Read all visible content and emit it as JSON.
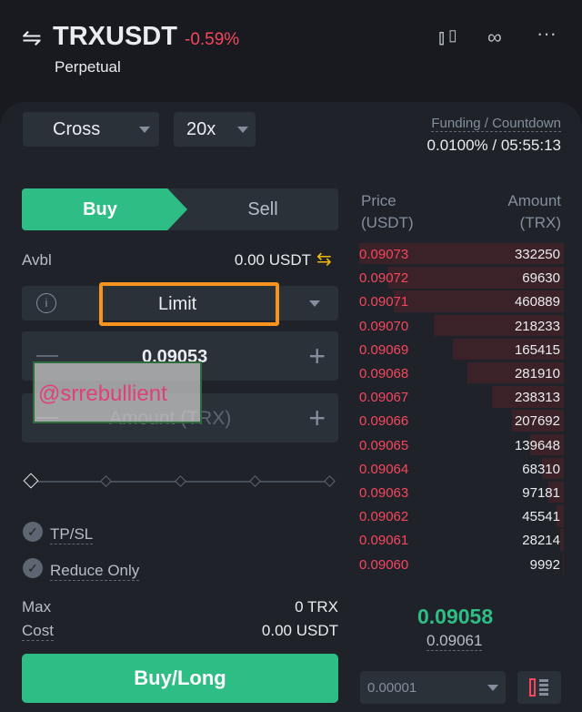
{
  "header": {
    "symbol": "TRXUSDT",
    "change": "-0.59%",
    "contract_type": "Perpetual",
    "icons": [
      "swap-icon",
      "candlestick-chart-icon",
      "link-icon",
      "more-icon"
    ]
  },
  "margin": {
    "mode": "Cross",
    "leverage": "20x"
  },
  "funding": {
    "label": "Funding / Countdown",
    "value": "0.0100% / 05:55:13"
  },
  "order": {
    "buy_label": "Buy",
    "sell_label": "Sell",
    "avbl_label": "Avbl",
    "avbl_value": "0.00 USDT",
    "order_type": "Limit",
    "price_value": "0.09053",
    "amount_placeholder": "Amount (TRX)",
    "slider_percent": 0,
    "tpsl_label": "TP/SL",
    "reduce_only_label": "Reduce Only",
    "max_label": "Max",
    "max_value": "0 TRX",
    "cost_label": "Cost",
    "cost_value": "0.00 USDT",
    "submit_label": "Buy/Long"
  },
  "watermark": "@srrebullient",
  "orderbook": {
    "price_header": "Price",
    "price_unit": "(USDT)",
    "amount_header": "Amount",
    "amount_unit": "(TRX)",
    "asks": [
      [
        "0.09073",
        "332250"
      ],
      [
        "0.09072",
        "69630"
      ],
      [
        "0.09071",
        "460889"
      ],
      [
        "0.09070",
        "218233"
      ],
      [
        "0.09069",
        "165415"
      ],
      [
        "0.09068",
        "281910"
      ],
      [
        "0.09067",
        "238313"
      ],
      [
        "0.09066",
        "207692"
      ],
      [
        "0.09065",
        "139648"
      ],
      [
        "0.09064",
        "68310"
      ],
      [
        "0.09063",
        "97181"
      ],
      [
        "0.09062",
        "45541"
      ],
      [
        "0.09061",
        "28214"
      ],
      [
        "0.09060",
        "9992"
      ]
    ],
    "last_price": "0.09058",
    "mark_price": "0.09061",
    "precision": "0.00001"
  },
  "colors": {
    "buy": "#2ebd85",
    "sell": "#f6465d",
    "accent": "#f0b90b",
    "highlight": "#f7931e"
  }
}
